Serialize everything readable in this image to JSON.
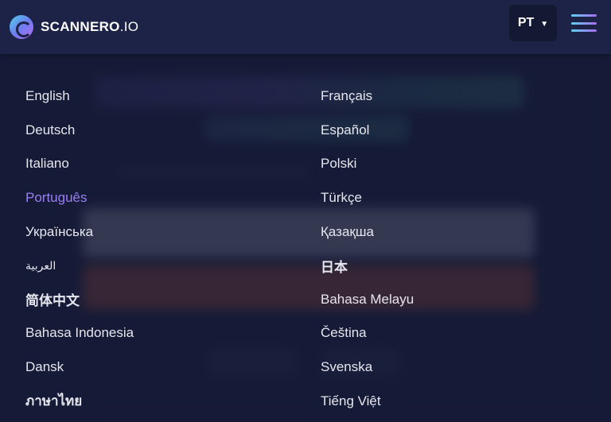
{
  "brand": {
    "name": "SCANNERO",
    "suffix": ".IO"
  },
  "header": {
    "current_language": "PT",
    "caret": "▼"
  },
  "languages": [
    {
      "label": "English"
    },
    {
      "label": "Français"
    },
    {
      "label": "Deutsch"
    },
    {
      "label": "Español"
    },
    {
      "label": "Italiano"
    },
    {
      "label": "Polski"
    },
    {
      "label": "Português",
      "active": true
    },
    {
      "label": "Türkçe"
    },
    {
      "label": "Українська"
    },
    {
      "label": "Қазақша"
    },
    {
      "label": "العربية"
    },
    {
      "label": "日本"
    },
    {
      "label": "简体中文"
    },
    {
      "label": "Bahasa Melayu"
    },
    {
      "label": "Bahasa Indonesia"
    },
    {
      "label": "Čeština"
    },
    {
      "label": "Dansk"
    },
    {
      "label": "Svenska"
    },
    {
      "label": "ภาษาไทย"
    },
    {
      "label": "Tiếng Việt"
    }
  ],
  "colors": {
    "active": "#9a7ff2",
    "background": "#1c2141",
    "text": "#e6e7ee"
  }
}
